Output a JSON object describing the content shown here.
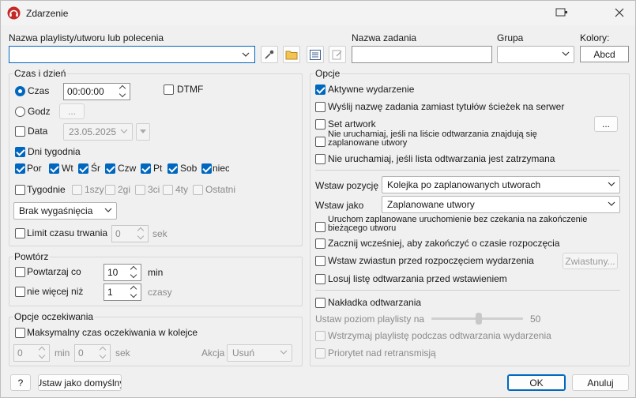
{
  "window": {
    "title": "Zdarzenie"
  },
  "top": {
    "playlist_label": "Nazwa playlisty/utworu lub polecenia",
    "playlist_value": "",
    "task_label": "Nazwa zadania",
    "task_value": "",
    "group_label": "Grupa",
    "group_value": "",
    "colors_label": "Kolory:",
    "colors_value": "Abcd"
  },
  "time_group": {
    "title": "Czas i dzień",
    "time_radio": "Czas",
    "time_value": "00:00:00",
    "dtmf": "DTMF",
    "hour_radio": "Godz",
    "hour_button": "...",
    "date_cb": "Data",
    "date_value": "23.05.2025",
    "weekdays_cb": "Dni tygodnia",
    "days": [
      "Por",
      "Wt",
      "Śr",
      "Czw",
      "Pt",
      "Sob",
      "niec"
    ],
    "weekly_cb": "Tygodnie",
    "weeks": [
      "1szy",
      "2gi",
      "3ci",
      "4ty",
      "Ostatni"
    ],
    "expiry_value": "Brak wygaśnięcia",
    "limit_cb": "Limit czasu trwania",
    "limit_value": "0",
    "limit_unit": "sek"
  },
  "repeat_group": {
    "title": "Powtórz",
    "repeat_cb": "Powtarzaj co",
    "repeat_value": "10",
    "repeat_unit": "min",
    "nomore_cb": "nie więcej niż",
    "nomore_value": "1",
    "nomore_unit": "czasy"
  },
  "wait_group": {
    "title": "Opcje oczekiwania",
    "maxwait_cb": "Maksymalny czas oczekiwania w kolejce",
    "min_value": "0",
    "min_unit": "min",
    "sek_value": "0",
    "sek_unit": "sek",
    "action_label": "Akcja",
    "action_value": "Usuń"
  },
  "options": {
    "title": "Opcje",
    "items": [
      "Aktywne wydarzenie",
      "Wyślij nazwę zadania zamiast tytułów ścieżek na serwer",
      "Set artwork",
      "Nie uruchamiaj, jeśli na liście odtwarzania znajdują się zaplanowane utwory",
      "Nie uruchamiaj, jeśli lista odtwarzania jest zatrzymana"
    ],
    "artwork_button": "...",
    "insert_pos_label": "Wstaw pozycję",
    "insert_pos_value": "Kolejka po zaplanowanych utworach",
    "insert_as_label": "Wstaw jako",
    "insert_as_value": "Zaplanowane utwory",
    "items2": [
      "Uruchom zaplanowane uruchomienie bez czekania na zakończenie bieżącego utworu",
      "Zacznij wcześniej, aby zakończyć o czasie rozpoczęcia",
      "Wstaw zwiastun przed rozpoczęciem wydarzenia",
      "Losuj listę odtwarzania przed wstawieniem"
    ],
    "trailers_button": "Zwiastuny...",
    "overlay_cb": "Nakładka odtwarzania",
    "level_label": "Ustaw poziom playlisty na",
    "level_value": "50",
    "level_fraction": 0.52,
    "pause_cb": "Wstrzymaj playlistę podczas odtwarzania wydarzenia",
    "priority_cb": "Priorytet nad retransmisją"
  },
  "footer": {
    "help": "?",
    "default": "Ustaw jako domyślny",
    "ok": "OK",
    "cancel": "Anuluj"
  }
}
